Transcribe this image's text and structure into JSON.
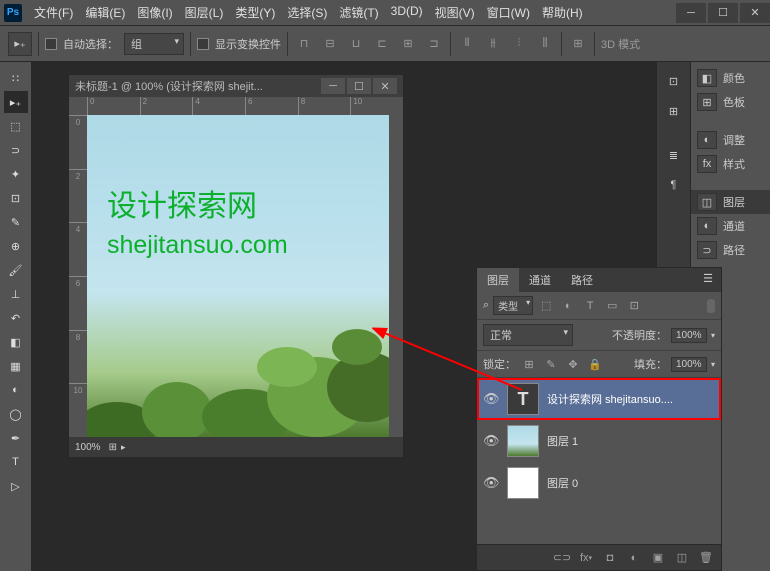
{
  "menu": [
    "文件(F)",
    "编辑(E)",
    "图像(I)",
    "图层(L)",
    "类型(Y)",
    "选择(S)",
    "滤镜(T)",
    "3D(D)",
    "视图(V)",
    "窗口(W)",
    "帮助(H)"
  ],
  "options": {
    "auto_select": "自动选择：",
    "group": "组",
    "show_transform": "显示变换控件",
    "mode_3d": "3D 模式"
  },
  "document": {
    "title": "未标题-1 @ 100% (设计探索网 shejit...",
    "canvas_text1": "设计探索网",
    "canvas_text2": "shejitansuo.com",
    "zoom": "100%",
    "ruler_h": [
      "0",
      "2",
      "4",
      "6",
      "8",
      "10"
    ],
    "ruler_v": [
      "0",
      "2",
      "4",
      "6",
      "8",
      "10"
    ]
  },
  "layers_panel": {
    "tabs": [
      "图层",
      "通道",
      "路径"
    ],
    "filter_label": "类型",
    "blend_mode": "正常",
    "opacity_label": "不透明度：",
    "opacity_value": "100%",
    "lock_label": "锁定：",
    "fill_label": "填充：",
    "fill_value": "100%",
    "layers": [
      {
        "name": "设计探索网 shejitansuo....",
        "type": "text",
        "visible": true,
        "selected": true
      },
      {
        "name": "图层 1",
        "type": "raster",
        "visible": true,
        "selected": false
      },
      {
        "name": "图层 0",
        "type": "raster-white",
        "visible": true,
        "selected": false
      }
    ]
  },
  "right_panels": {
    "color": "颜色",
    "swatches": "色板",
    "adjustments": "调整",
    "styles": "样式",
    "layers": "图层",
    "channels": "通道",
    "paths": "路径"
  }
}
